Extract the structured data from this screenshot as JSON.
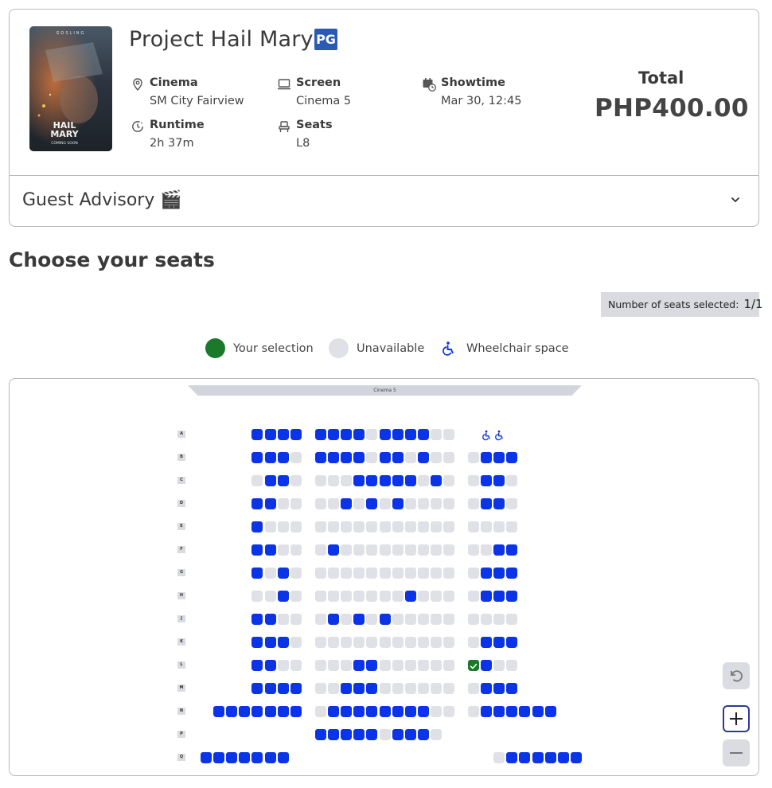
{
  "movie": {
    "title": "Project Hail Mary",
    "rating": "PG",
    "poster": {
      "top_text": "GOSLING",
      "title_line1": "HAIL",
      "title_line2": "MARY",
      "footer": "COMING SOON"
    }
  },
  "details": {
    "cinema": {
      "label": "Cinema",
      "value": "SM City Fairview",
      "icon": "location-pin-icon"
    },
    "screen": {
      "label": "Screen",
      "value": "Cinema 5",
      "icon": "monitor-icon"
    },
    "showtime": {
      "label": "Showtime",
      "value": "Mar 30, 12:45",
      "icon": "calendar-clock-icon"
    },
    "runtime": {
      "label": "Runtime",
      "value": "2h 37m",
      "icon": "clock-icon"
    },
    "seats": {
      "label": "Seats",
      "value": "L8",
      "icon": "seat-icon"
    }
  },
  "total": {
    "label": "Total",
    "value": "PHP400.00"
  },
  "advisory": {
    "label": "Guest Advisory 🎬"
  },
  "section_title": "Choose your seats",
  "seat_count": {
    "label": "Number of seats selected:",
    "value": "1/1"
  },
  "legend": {
    "selection": "Your selection",
    "unavailable": "Unavailable",
    "wheelchair": "Wheelchair space"
  },
  "colors": {
    "available": "#0b33e8",
    "unavailable": "#dfe1e6",
    "selected": "#1a7a2a",
    "rating_badge": "#2a5ab1"
  },
  "seatmap": {
    "screen_label": "Cinema 5",
    "row_labels": [
      "A",
      "B",
      "C",
      "D",
      "E",
      "F",
      "G",
      "H",
      "J",
      "K",
      "L",
      "M",
      "N",
      "P",
      "Q"
    ],
    "rows": [
      {
        "label": "A",
        "left": "....AAAA",
        "mid": "AAAAUAAAAUU",
        "right": ".WW......"
      },
      {
        "label": "B",
        "left": "....AAAU",
        "mid": "AAAAUAAUAUU",
        "right": "UAAA....."
      },
      {
        "label": "C",
        "left": "....UAAU",
        "mid": "UUUAAAAAUAU",
        "right": "UAAU....."
      },
      {
        "label": "D",
        "left": "....AAUU",
        "mid": "UUAUAUAUUUU",
        "right": "UAAU....."
      },
      {
        "label": "E",
        "left": "....AUUU",
        "mid": "UUUUUUUUUUU",
        "right": "UUUU....."
      },
      {
        "label": "F",
        "left": "....AAUU",
        "mid": "UAUUUUUUUUU",
        "right": "UUAA....."
      },
      {
        "label": "G",
        "left": "....AUAU",
        "mid": "UUUUUUUUUUU",
        "right": "UAAA....."
      },
      {
        "label": "H",
        "left": "....UUAU",
        "mid": "UUUUUUUAUUU",
        "right": "UAAA....."
      },
      {
        "label": "J",
        "left": "....AAUU",
        "mid": "UAUAUAUUUUU",
        "right": "UUUU....."
      },
      {
        "label": "K",
        "left": "....AAAU",
        "mid": "UUUUUUUUUUU",
        "right": "UAAA....."
      },
      {
        "label": "L",
        "left": "....AAUU",
        "mid": "UUUAAUUUUUU",
        "right": "SAUU....."
      },
      {
        "label": "M",
        "left": "....AAAA",
        "mid": "UUAAAUUUUUU",
        "right": "UAAA....."
      },
      {
        "label": "N",
        "left": ".AAAAAAA",
        "mid": "UAAAAAAAAUU",
        "right": "UAAAAAA.."
      },
      {
        "label": "P",
        "left": "........",
        "mid": "AAAAAUAAAU.",
        "right": "........."
      },
      {
        "label": "Q",
        "left": "AAAAAAA.",
        "mid": "...........",
        "right": "..UAAAAAA"
      }
    ]
  },
  "controls": {
    "reset": "undo-icon",
    "zoom_in": "plus-icon",
    "zoom_out": "minus-icon"
  }
}
